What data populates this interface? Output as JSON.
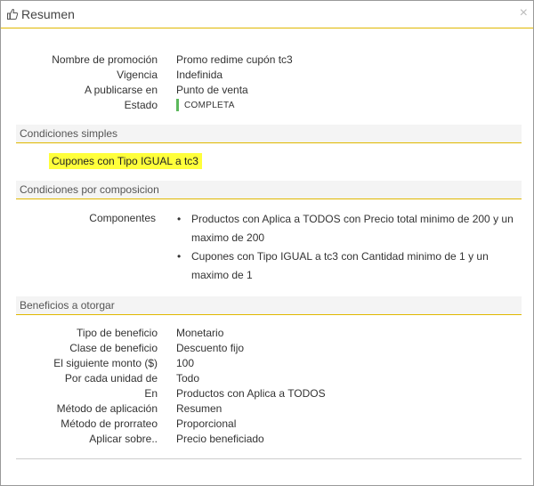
{
  "modal": {
    "title": "Resumen",
    "close_glyph": "×",
    "title_icon": "thumbs-up-icon"
  },
  "summary": [
    {
      "label": "Nombre de promoción",
      "value": "Promo redime cupón tc3"
    },
    {
      "label": "Vigencia",
      "value": "Indefinida"
    },
    {
      "label": "A publicarse en",
      "value": "Punto de venta"
    },
    {
      "label": "Estado",
      "value": "COMPLETA"
    }
  ],
  "status_color": "#5cb85c",
  "sections": {
    "simple": {
      "title": "Condiciones simples",
      "item": "Cupones con Tipo IGUAL a tc3"
    },
    "composition": {
      "title": "Condiciones por composicion",
      "label": "Componentes",
      "items": [
        "Productos con Aplica a TODOS con Precio total minimo de 200 y un maximo de 200",
        "Cupones con Tipo IGUAL a tc3 con Cantidad minimo de 1 y un maximo de 1"
      ]
    },
    "benefits": {
      "title": "Beneficios a otorgar",
      "rows": [
        {
          "label": "Tipo de beneficio",
          "value": "Monetario"
        },
        {
          "label": "Clase de beneficio",
          "value": "Descuento fijo"
        },
        {
          "label": "El siguiente monto ($)",
          "value": "100"
        },
        {
          "label": "Por cada unidad de",
          "value": "Todo"
        },
        {
          "label": "En",
          "value": "Productos con Aplica a TODOS"
        },
        {
          "label": "Método de aplicación",
          "value": "Resumen"
        },
        {
          "label": "Método de prorrateo",
          "value": "Proporcional"
        },
        {
          "label": "Aplicar sobre..",
          "value": "Precio beneficiado"
        }
      ]
    }
  },
  "accent_color": "#e0b800",
  "highlight_color": "#ffff3b"
}
